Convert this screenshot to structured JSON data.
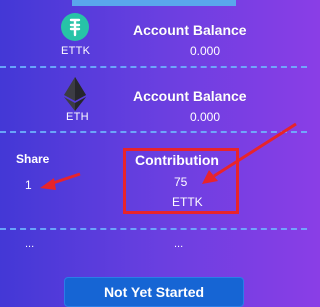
{
  "coins": [
    {
      "icon": "ettk-coin-icon",
      "symbol": "ETTK",
      "balance_title": "Account Balance",
      "balance_value": "0.000"
    },
    {
      "icon": "ethereum-icon",
      "symbol": "ETH",
      "balance_title": "Account Balance",
      "balance_value": "0.000"
    }
  ],
  "share": {
    "label": "Share",
    "value": "1"
  },
  "contribution": {
    "label": "Contribution",
    "value": "75",
    "unit": "ETTK"
  },
  "placeholders": [
    "...",
    "..."
  ],
  "status_button": {
    "label": "Not Yet Started"
  },
  "colors": {
    "accent": "#1665d4",
    "annotation": "#e8242b",
    "ettk_icon": "#27c3a7",
    "divider": "#6fb7ff"
  }
}
